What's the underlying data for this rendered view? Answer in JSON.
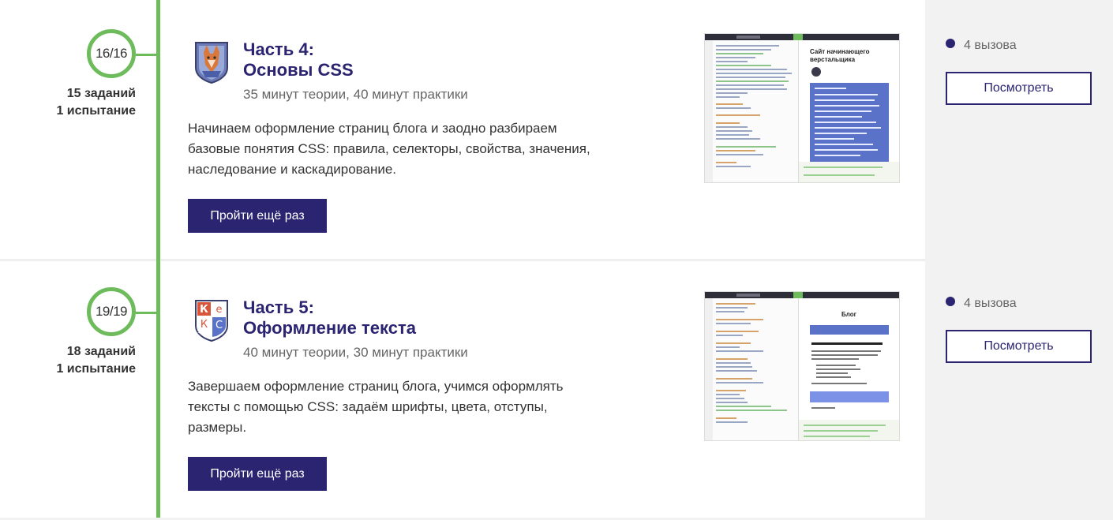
{
  "colors": {
    "accent": "#2a2471",
    "progress": "#6dbb5a"
  },
  "sections": [
    {
      "progress": "16/16",
      "tasks": "15 заданий",
      "trials": "1 испытание",
      "badge_icon": "fox-crest-icon",
      "title_line1": "Часть 4:",
      "title_line2": "Основы CSS",
      "time": "35 минут теории, 40 минут практики",
      "description": "Начинаем оформление страниц блога и заодно разбираем базовые понятия CSS: правила, селекторы, свойства, значения, наследование и каскадирование.",
      "button": "Пройти ещё раз",
      "preview_title": "Сайт начинающего верстальщика",
      "challenges": "4 вызова",
      "view_button": "Посмотреть"
    },
    {
      "progress": "19/19",
      "tasks": "18 заданий",
      "trials": "1 испытание",
      "badge_icon": "keks-crest-icon",
      "badge_letters": [
        "К",
        "е",
        "К",
        "С"
      ],
      "title_line1": "Часть 5:",
      "title_line2": "Оформление текста",
      "time": "40 минут теории, 30 минут практики",
      "description": "Завершаем оформление страниц блога, учимся оформлять тексты с помощью CSS: задаём шрифты, цвета, отступы, размеры.",
      "button": "Пройти ещё раз",
      "preview_title": "Блог",
      "challenges": "4 вызова",
      "view_button": "Посмотреть"
    }
  ]
}
